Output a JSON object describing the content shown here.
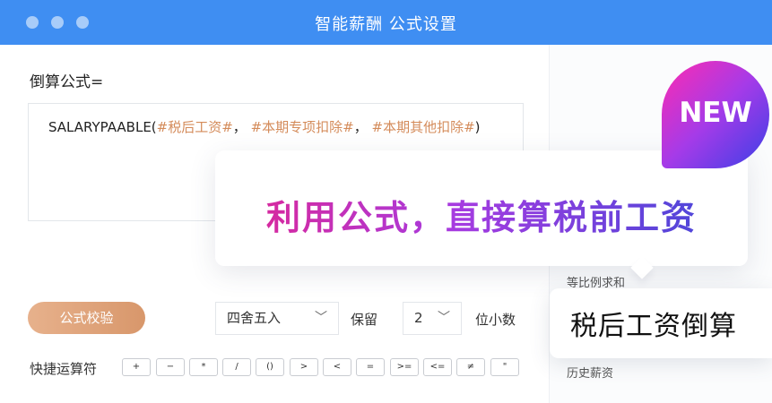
{
  "window": {
    "title": "智能薪酬 公式设置"
  },
  "editor": {
    "formula_label": "倒算公式=",
    "formula_func": "SALARYPAABLE(",
    "var1": "#税后工资#",
    "sep1": "，  ",
    "var2": "#本期专项扣除#",
    "sep2": "，  ",
    "var3": "#本期其他扣除#",
    "close": ")"
  },
  "toolbar": {
    "verify_label": "公式校验",
    "rounding_value": "四舍五入",
    "keep_label": "保留",
    "decimals_value": "2",
    "decimals_suffix": "位小数"
  },
  "operators": {
    "label": "快捷运算符",
    "items": [
      "+",
      "−",
      "*",
      "/",
      "()",
      ">",
      "<",
      "=",
      ">=",
      "<=",
      "≠",
      "\""
    ]
  },
  "sidebar": {
    "item_ratio": "等比例求和",
    "item_history": "历史薪资"
  },
  "promo": {
    "headline": "利用公式，直接算税前工资",
    "feature": "税后工资倒算",
    "badge": "NEW"
  }
}
